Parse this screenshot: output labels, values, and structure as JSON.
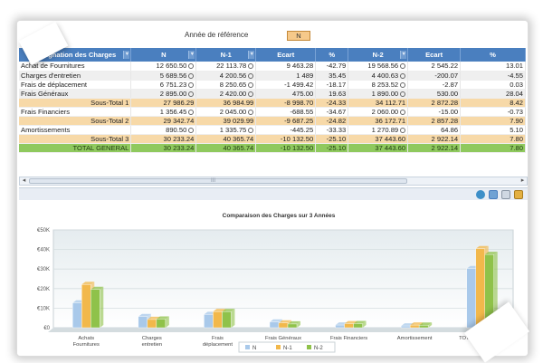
{
  "header": {
    "reference_year_label": "Année de référence",
    "reference_year_value": "N"
  },
  "table": {
    "columns": [
      "Désignation des Charges",
      "N",
      "N-1",
      "Ecart",
      "%",
      "N-2",
      "Ecart",
      "%"
    ],
    "rows": [
      {
        "type": "odd",
        "label": "Achat de Fournitures",
        "n": "12 650.50",
        "n1": "22 113.78",
        "ecart": "9 463.28",
        "pct": "-42.79",
        "n2": "19 568.56",
        "ecart2": "2 545.22",
        "pct2": "13.01"
      },
      {
        "type": "even",
        "label": "Charges d'entretien",
        "n": "5 689.56",
        "n1": "4 200.56",
        "ecart": "1 489",
        "pct": "35.45",
        "n2": "4 400.63",
        "ecart2": "-200.07",
        "pct2": "-4.55"
      },
      {
        "type": "odd",
        "label": "Frais de déplacement",
        "n": "6 751.23",
        "n1": "8 250.65",
        "ecart": "-1 499.42",
        "pct": "-18.17",
        "n2": "8 253.52",
        "ecart2": "-2.87",
        "pct2": "0.03"
      },
      {
        "type": "even",
        "label": "Frais Généraux",
        "n": "2 895.00",
        "n1": "2 420.00",
        "ecart": "475.00",
        "pct": "19.63",
        "n2": "1 890.00",
        "ecart2": "530.00",
        "pct2": "28.04"
      },
      {
        "type": "sub",
        "label": "Sous-Total 1",
        "n": "27 986.29",
        "n1": "36 984.99",
        "ecart": "-8 998.70",
        "pct": "-24.33",
        "n2": "34 112.71",
        "ecart2": "2 872.28",
        "pct2": "8.42"
      },
      {
        "type": "odd",
        "label": "Frais Financiers",
        "n": "1 356.45",
        "n1": "2 045.00",
        "ecart": "-688.55",
        "pct": "-34.67",
        "n2": "2 060.00",
        "ecart2": "-15.00",
        "pct2": "-0.73"
      },
      {
        "type": "sub",
        "label": "Sous-Total 2",
        "n": "29 342.74",
        "n1": "39 029.99",
        "ecart": "-9 687.25",
        "pct": "-24.82",
        "n2": "36 172.71",
        "ecart2": "2 857.28",
        "pct2": "7.90"
      },
      {
        "type": "odd",
        "label": "Amortissements",
        "n": "890.50",
        "n1": "1 335.75",
        "ecart": "-445.25",
        "pct": "-33.33",
        "n2": "1 270.89",
        "ecart2": "64.86",
        "pct2": "5.10"
      },
      {
        "type": "sub",
        "label": "Sous-Total 3",
        "n": "30 233.24",
        "n1": "40 365.74",
        "ecart": "-10 132.50",
        "pct": "-25.10",
        "n2": "37 443.60",
        "ecart2": "2 922.14",
        "pct2": "7.80"
      },
      {
        "type": "total",
        "label": "TOTAL GENERAL",
        "n": "30 233.24",
        "n1": "40 365.74",
        "ecart": "-10 132.50",
        "pct": "-25.10",
        "n2": "37 443.60",
        "ecart2": "2 922.14",
        "pct2": "7.80"
      }
    ]
  },
  "scrollbar": {
    "grip": "III"
  },
  "toolbar": {
    "icons": [
      "refresh-icon",
      "export-icon",
      "print-icon",
      "grid-icon"
    ]
  },
  "chart_data": {
    "type": "bar",
    "title": "Comparaison des Charges sur 3 Années",
    "categories": [
      "Achats Fournitures",
      "Charges entretien",
      "Frais déplacement",
      "Frais Généraux",
      "Frais Financiers",
      "Amortissement",
      "TOTAL GENERAL"
    ],
    "series": [
      {
        "name": "N",
        "color": "#a9c9ea",
        "values": [
          12650.5,
          5689.56,
          6751.23,
          2895,
          1356.45,
          890.5,
          30233.24
        ]
      },
      {
        "name": "N-1",
        "color": "#f2b84b",
        "values": [
          22113.78,
          4200.56,
          8250.65,
          2420,
          2045,
          1335.75,
          40365.74
        ]
      },
      {
        "name": "N-2",
        "color": "#8fc24a",
        "values": [
          19568.56,
          4400.63,
          8253.52,
          1890,
          2060,
          1270.89,
          37443.6
        ]
      }
    ],
    "y_ticks": [
      "€0",
      "€10K",
      "€20K",
      "€30K",
      "€40K",
      "€50K"
    ],
    "ylim": [
      0,
      50000
    ],
    "legend_position": "bottom"
  }
}
